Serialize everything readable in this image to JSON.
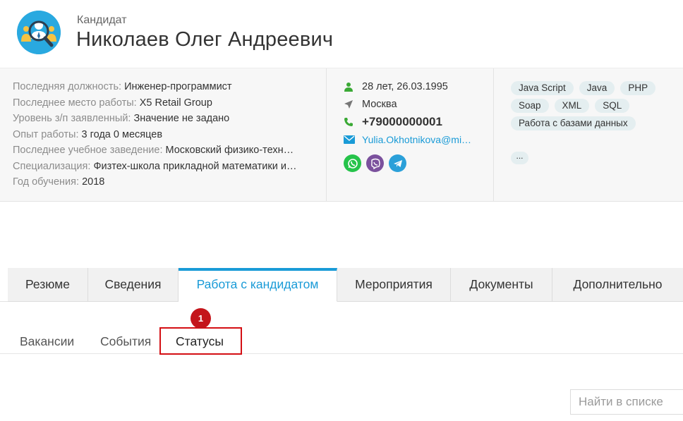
{
  "header": {
    "kind": "Кандидат",
    "name": "Николаев Олег Андреевич"
  },
  "profile": {
    "rows": [
      {
        "label": "Последняя должность:",
        "value": "Инженер-программист"
      },
      {
        "label": "Последнее место работы:",
        "value": "X5 Retail Group"
      },
      {
        "label": "Уровень з/п заявленный:",
        "value": "Значение не задано"
      },
      {
        "label": "Опыт работы:",
        "value": "3 года 0 месяцев"
      },
      {
        "label": "Последнее учебное заведение:",
        "value": "Московский физико-техн…"
      },
      {
        "label": "Специализация:",
        "value": "Физтех-школа прикладной математики и…"
      },
      {
        "label": "Год обучения:",
        "value": "2018"
      }
    ]
  },
  "contacts": {
    "age": "28 лет, 26.03.1995",
    "city": "Москва",
    "phone": "+79000000001",
    "email": "Yulia.Okhotnikova@mi…",
    "icons": {
      "age": "person-icon",
      "city": "location-arrow-icon",
      "phone": "phone-icon",
      "email": "envelope-icon"
    },
    "messengers": [
      {
        "name": "whatsapp-icon",
        "color": "#25c34a"
      },
      {
        "name": "viber-icon",
        "color": "#7b519d"
      },
      {
        "name": "telegram-icon",
        "color": "#2ba0d9"
      }
    ]
  },
  "skills": {
    "tags": [
      "Java Script",
      "Java",
      "PHP",
      "Soap",
      "XML",
      "SQL",
      "Работа с базами данных"
    ],
    "more": "..."
  },
  "tabs": [
    {
      "label": "Резюме",
      "active": false
    },
    {
      "label": "Сведения",
      "active": false
    },
    {
      "label": "Работа с кандидатом",
      "active": true
    },
    {
      "label": "Мероприятия",
      "active": false
    },
    {
      "label": "Документы",
      "active": false
    },
    {
      "label": "Дополнительно",
      "active": false
    }
  ],
  "subtabs": [
    {
      "label": "Вакансии",
      "selected": false
    },
    {
      "label": "События",
      "selected": false
    },
    {
      "label": "Статусы",
      "selected": true
    }
  ],
  "annotation": {
    "badge": "1",
    "color": "#c4151b"
  },
  "search": {
    "placeholder": "Найти в списке"
  },
  "colors": {
    "accent": "#1a9bd7",
    "highlight": "#d40f14",
    "green": "#3aa935"
  }
}
